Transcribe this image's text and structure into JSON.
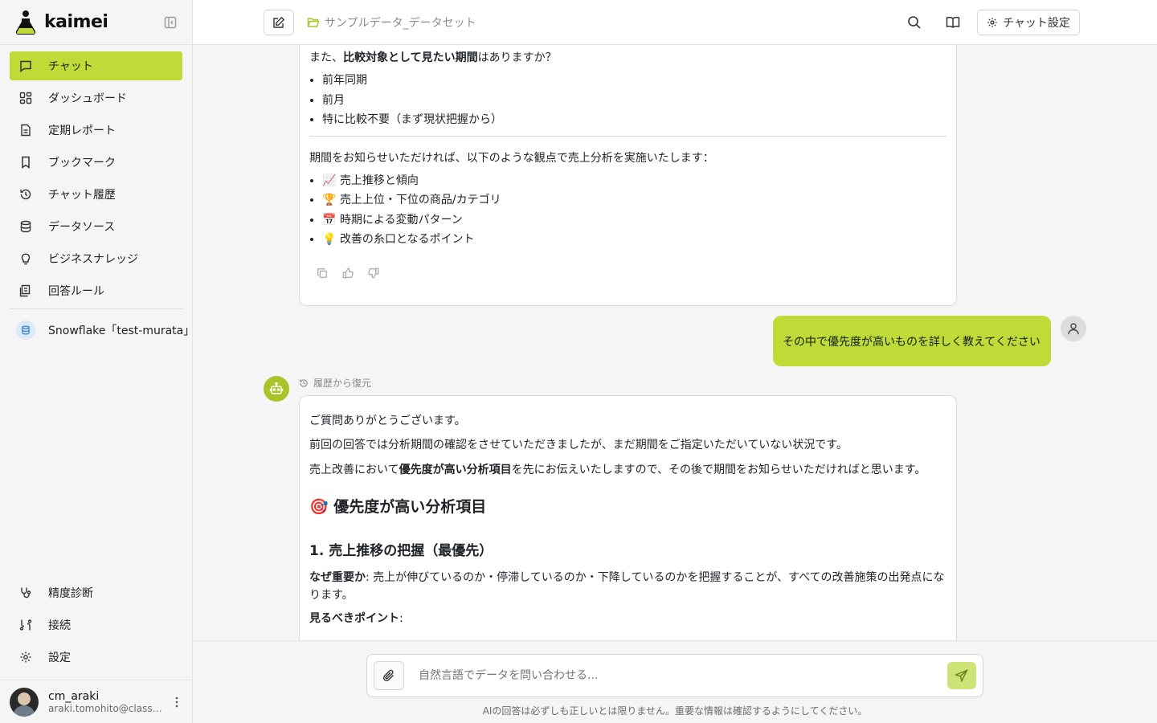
{
  "brand": {
    "name": "kaimei"
  },
  "sidebar": {
    "items": [
      {
        "label": "チャット",
        "icon": "chat-icon",
        "active": true
      },
      {
        "label": "ダッシュボード",
        "icon": "dashboard-icon"
      },
      {
        "label": "定期レポート",
        "icon": "report-icon"
      },
      {
        "label": "ブックマーク",
        "icon": "bookmark-icon"
      },
      {
        "label": "チャット履歴",
        "icon": "history-icon"
      },
      {
        "label": "データソース",
        "icon": "database-icon"
      },
      {
        "label": "ビジネスナレッジ",
        "icon": "lightbulb-icon"
      },
      {
        "label": "回答ルール",
        "icon": "rules-icon"
      }
    ],
    "datasource": {
      "label": "Snowflake「test-murata」"
    },
    "bottom_items": [
      {
        "label": "精度診断",
        "icon": "stethoscope-icon"
      },
      {
        "label": "接続",
        "icon": "connection-icon"
      },
      {
        "label": "設定",
        "icon": "gear-icon"
      }
    ],
    "user": {
      "name": "cm_araki",
      "email": "araki.tomohito@classmethod.jp"
    }
  },
  "header": {
    "breadcrumb": "サンプルデータ_データセット",
    "chat_settings_label": "チャット設定"
  },
  "messages": {
    "prev": {
      "intro_before": "また、",
      "intro_bold": "比較対象として見たい期間",
      "intro_after": "はありますか？",
      "options": [
        "前年同期",
        "前月",
        "特に比較不要（まず現状把握から）"
      ],
      "lead": "期間をお知らせいただければ、以下のような観点で売上分析を実施いたします：",
      "points": [
        "📈 売上推移と傾向",
        "🏆 売上上位・下位の商品/カテゴリ",
        "📅 時期による変動パターン",
        "💡 改善の糸口となるポイント"
      ]
    },
    "user_message": "その中で優先度が高いものを詳しく教えてください",
    "restored_label": "履歴から復元",
    "reply": {
      "p1": "ご質問ありがとうございます。",
      "p2": "前回の回答では分析期間の確認をさせていただきましたが、まだ期間をご指定いただいていない状況です。",
      "p3_before": "売上改善において",
      "p3_bold": "優先度が高い分析項目",
      "p3_after": "を先にお伝えいたしますので、その後で期間をお知らせいただければと思います。",
      "h2": "🎯 優先度が高い分析項目",
      "h3": "1. 売上推移の把握（最優先）",
      "why_label": "なぜ重要か",
      "why_text": ": 売上が伸びているのか・停滞しているのか・下降しているのかを把握することが、すべての改善施策の出発点になります。",
      "points_label": "見るべきポイント",
      "points_suffix": ":"
    }
  },
  "composer": {
    "placeholder": "自然言語でデータを問い合わせる...",
    "disclaimer": "AIの回答は必ずしも正しいとは限りません。重要な情報は確認するようにしてください。"
  },
  "colors": {
    "accent": "#bfdb38",
    "background": "#f5f5f5"
  }
}
